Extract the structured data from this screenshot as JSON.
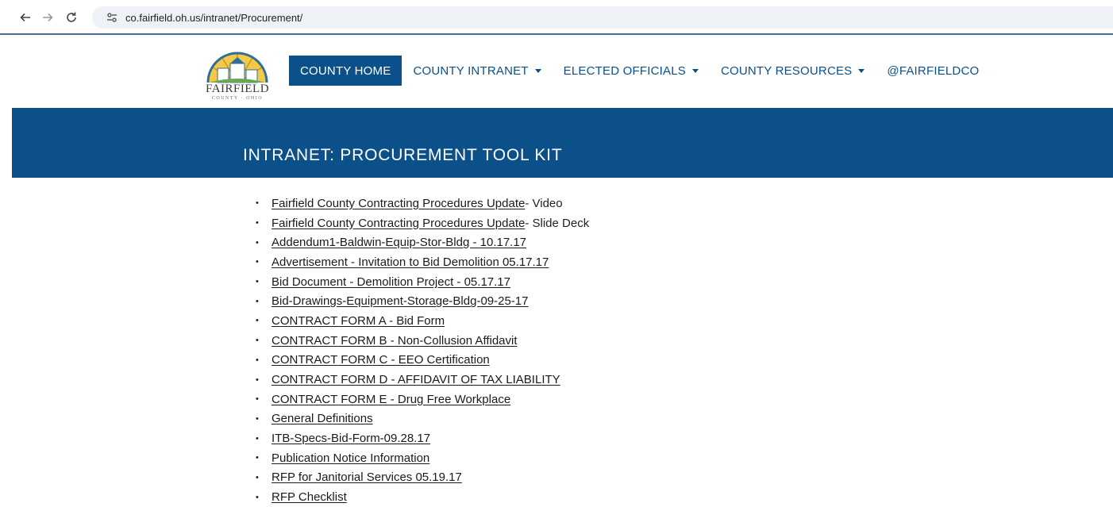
{
  "browser": {
    "url": "co.fairfield.oh.us/intranet/Procurement/"
  },
  "logo": {
    "name": "FAIRFIELD",
    "subtitle": "COUNTY · OHIO"
  },
  "nav": {
    "items": [
      {
        "label": "COUNTY HOME",
        "active": true
      },
      {
        "label": "COUNTY INTRANET",
        "dropdown": true
      },
      {
        "label": "ELECTED OFFICIALS",
        "dropdown": true
      },
      {
        "label": "COUNTY RESOURCES",
        "dropdown": true
      },
      {
        "label": "@FAIRFIELDCO"
      }
    ]
  },
  "banner": {
    "title": "INTRANET: PROCUREMENT TOOL KIT"
  },
  "documents": [
    {
      "link": "Fairfield County Contracting Procedures Update",
      "suffix": " - Video"
    },
    {
      "link": "Fairfield County Contracting Procedures Update",
      "suffix": " - Slide Deck"
    },
    {
      "link": "Addendum1-Baldwin-Equip-Stor-Bldg - 10.17.17",
      "suffix": ""
    },
    {
      "link": "Advertisement - Invitation to Bid Demolition 05.17.17",
      "suffix": ""
    },
    {
      "link": "Bid Document - Demolition Project - 05.17.17",
      "suffix": ""
    },
    {
      "link": "Bid-Drawings-Equipment-Storage-Bldg-09-25-17",
      "suffix": ""
    },
    {
      "link": "CONTRACT FORM A - Bid Form",
      "suffix": ""
    },
    {
      "link": "CONTRACT FORM B - Non-Collusion Affidavit",
      "suffix": ""
    },
    {
      "link": "CONTRACT FORM C - EEO Certification",
      "suffix": ""
    },
    {
      "link": "CONTRACT FORM D - AFFIDAVIT OF TAX LIABILITY",
      "suffix": ""
    },
    {
      "link": "CONTRACT FORM E - Drug Free Workplace",
      "suffix": ""
    },
    {
      "link": "General Definitions",
      "suffix": ""
    },
    {
      "link": "ITB-Specs-Bid-Form-09.28.17",
      "suffix": ""
    },
    {
      "link": "Publication Notice Information",
      "suffix": ""
    },
    {
      "link": "RFP for Janitorial Services 05.19.17",
      "suffix": ""
    },
    {
      "link": "RFP Checklist",
      "suffix": ""
    }
  ],
  "colors": {
    "brand_blue": "#0c5089",
    "link_blue": "#0b4f8a"
  },
  "icons": {
    "back": "back-arrow-icon",
    "forward": "forward-arrow-icon",
    "reload": "reload-icon",
    "site_settings": "tune-icon"
  }
}
